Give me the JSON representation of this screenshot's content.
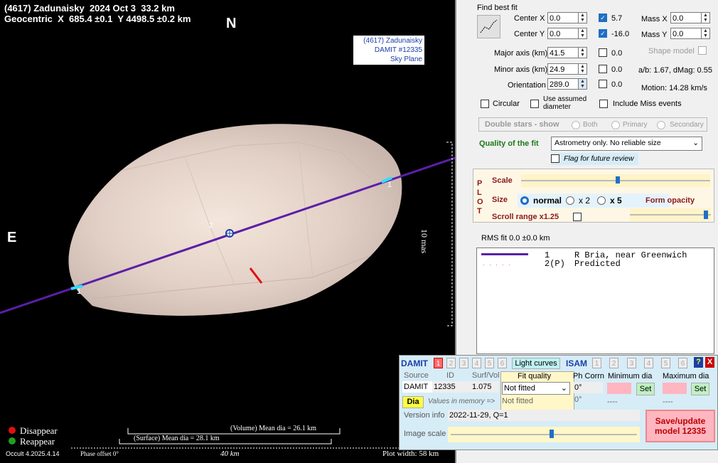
{
  "plot": {
    "title_line1": "(4617) Zadunaisky  2024 Oct 3  33.2 km",
    "title_line2": "Geocentric  X  685.4 ±0.1  Y 4498.5 ±0.2 km",
    "north": "N",
    "east": "E",
    "info_box": [
      "(4617) Zadunaisky",
      "DAMIT #12335",
      "Sky Plane"
    ],
    "scale_label": "10 mas",
    "chord1_label": "1",
    "chord2_label": "2",
    "legend_disappear": "Disappear",
    "legend_reappear": "Reappear",
    "volume_dia": "(Volume) Mean dia = 26.1 km",
    "surface_dia": "(Surface) Mean dia = 28.1 km",
    "km_scale": "40 km",
    "version": "Occult 4.2025.4.14",
    "phase_offset": "Phase offset 0°",
    "plot_width": "Plot width: 58 km",
    "colors": {
      "chord": "#5a1fa8",
      "disappear": "#e01010",
      "reappear": "#20a020"
    }
  },
  "fit": {
    "find_best_fit": "Find best fit",
    "center_x_label": "Center X",
    "center_x": "0.0",
    "center_y_label": "Center Y",
    "center_y": "0.0",
    "cx_check": "5.7",
    "cy_check": "-16.0",
    "mass_x_label": "Mass X",
    "mass_x": "0.0",
    "mass_y_label": "Mass Y",
    "mass_y": "0.0",
    "shape_model": "Shape model",
    "major_label": "Major axis (km)",
    "major": "41.5",
    "major_check": "0.0",
    "minor_label": "Minor axis (km)",
    "minor": "24.9",
    "minor_check": "0.0",
    "ab_info": "a/b: 1.67, dMag: 0.55",
    "orient_label": "Orientation",
    "orient": "289.0",
    "orient_check": "0.0",
    "motion": "Motion: 14.28 km/s",
    "circular": "Circular",
    "use_assumed": "Use assumed diameter",
    "include_miss": "Include Miss events"
  },
  "double_stars": {
    "label": "Double stars - show",
    "both": "Both",
    "primary": "Primary",
    "secondary": "Secondary"
  },
  "quality": {
    "label": "Quality of the fit",
    "value": "Astrometry only. No reliable size",
    "flag": "Flag for future review"
  },
  "plot_opts": {
    "plot_letters": "PLOT",
    "scale": "Scale",
    "size": "Size",
    "normal": "normal",
    "x2": "x 2",
    "x5": "x 5",
    "form_opacity": "Form opacity",
    "scroll_range": "Scroll range x1.25"
  },
  "rms": "RMS fit  0.0 ±0.0 km",
  "observers": [
    {
      "num": "1",
      "name": "R Bria, near Greenwich"
    },
    {
      "num": "2(P)",
      "name": "Predicted"
    }
  ],
  "damit": {
    "title": "DAMIT",
    "tabs": [
      "1",
      "2",
      "3",
      "4",
      "5",
      "6"
    ],
    "light_curves": "Light curves",
    "isam": "ISAM",
    "isam_tabs": [
      "1",
      "2",
      "3",
      "4",
      "5",
      "6"
    ],
    "help": "?",
    "close": "X",
    "source_h": "Source",
    "id_h": "ID",
    "surf_h": "Surf/Vol",
    "fit_quality_h": "Fit quality",
    "ph_corr_h": "Ph Corrn",
    "min_dia_h": "Minimum dia",
    "max_dia_h": "Maximum dia",
    "source": "DAMIT",
    "id": "12335",
    "surf": "1.075",
    "fit1": "Not fitted",
    "fit2": "Not fitted",
    "ph1": "0°",
    "ph2": "0°",
    "dashes1": "----",
    "dashes2": "----",
    "set": "Set",
    "dia": "Dia",
    "values_mem": "Values in memory =>",
    "version_label": "Version info",
    "version": "2022-11-29, Q=1",
    "image_scale": "Image scale",
    "save": "Save/update model 12335"
  }
}
